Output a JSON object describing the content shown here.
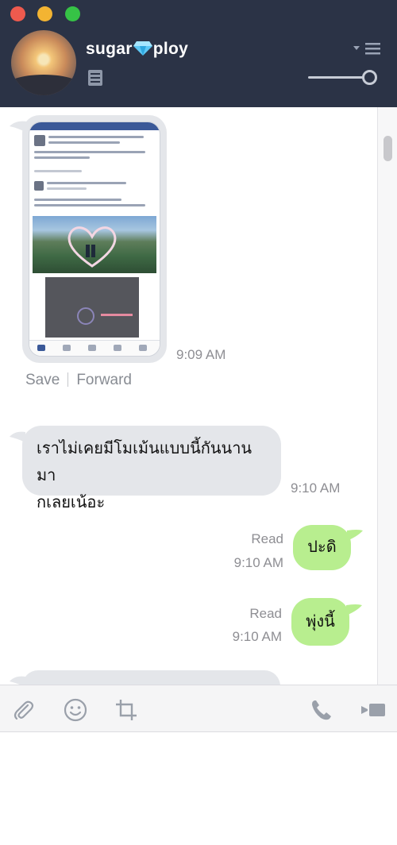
{
  "header": {
    "contact_name_part1": "sugar",
    "contact_name_part2": "ploy",
    "diamond_icon": "blue-diamond-emoji",
    "note_icon": "note-icon",
    "menu_icon": "dropdown-menu-icon"
  },
  "messages": {
    "image_message": {
      "time": "9:09 AM",
      "save_label": "Save",
      "forward_label": "Forward"
    },
    "incoming_1": {
      "text_line1": "เราไม่เคยมีโมเม้นแบบนี้กันนานมา",
      "text_line2": "กเลยเน้อะ",
      "time": "9:10 AM"
    },
    "outgoing_1": {
      "text": "ปะดิ",
      "status": "Read",
      "time": "9:10 AM"
    },
    "outgoing_2": {
      "text": "พุ่งนี้",
      "status": "Read",
      "time": "9:10 AM"
    }
  },
  "toolbar": {
    "attach_icon": "paperclip-icon",
    "emoji_icon": "smiley-icon",
    "crop_icon": "crop-icon",
    "call_icon": "phone-icon",
    "video_icon": "video-icon"
  },
  "colors": {
    "header_bg": "#2b3346",
    "incoming_bubble": "#e4e6ea",
    "outgoing_bubble": "#b8ee8f"
  }
}
